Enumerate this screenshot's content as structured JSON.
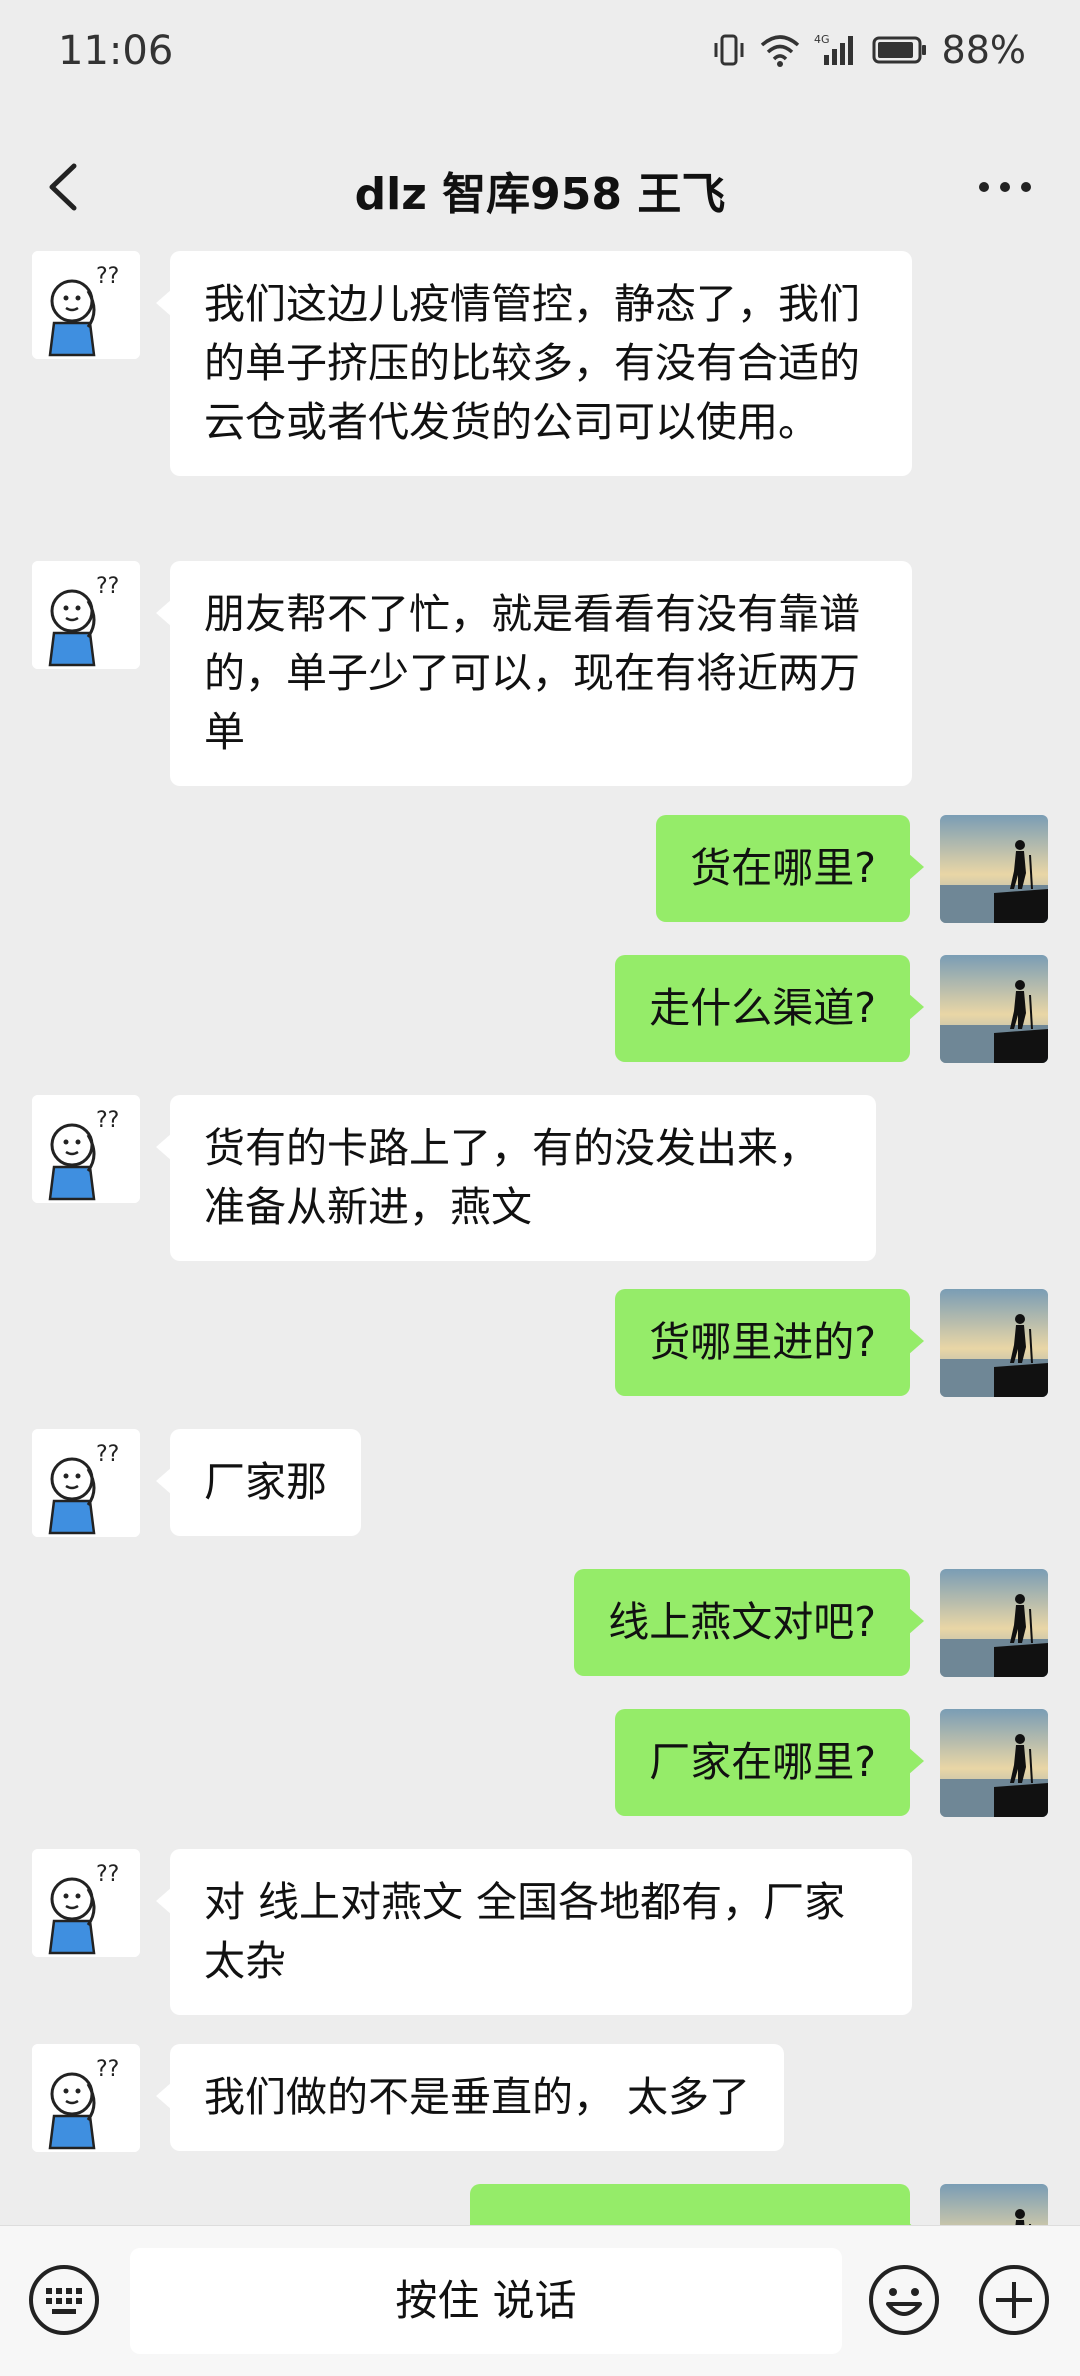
{
  "status_bar": {
    "time": "11:06",
    "battery": "88%",
    "network": "4G"
  },
  "header": {
    "title": "dlz 智库958 王飞"
  },
  "messages": [
    {
      "side": "left",
      "text": "我们这边儿疫情管控，静态了，我们的单子挤压的比较多，有没有合适的云仓或者代发货的公司可以使用。"
    },
    {
      "side": "left",
      "text": "朋友帮不了忙，就是看看有没有靠谱的，单子少了可以，现在有将近两万单"
    },
    {
      "side": "right",
      "text": "货在哪里?"
    },
    {
      "side": "right",
      "text": "走什么渠道?"
    },
    {
      "side": "left",
      "text": "货有的卡路上了，有的没发出来，准备从新进，燕文"
    },
    {
      "side": "right",
      "text": "货哪里进的?"
    },
    {
      "side": "left",
      "text": "厂家那"
    },
    {
      "side": "right",
      "text": "线上燕文对吧?"
    },
    {
      "side": "right",
      "text": "厂家在哪里?"
    },
    {
      "side": "left",
      "text": "对 线上对燕文  全国各地都有，厂家太杂"
    },
    {
      "side": "left",
      "text": "我们做的不是垂直的， 太多了"
    },
    {
      "side": "right",
      "text": ""
    }
  ],
  "input_bar": {
    "talk_label": "按住 说话"
  },
  "colors": {
    "background": "#ededed",
    "own_bubble": "#95ec69",
    "other_bubble": "#ffffff"
  }
}
